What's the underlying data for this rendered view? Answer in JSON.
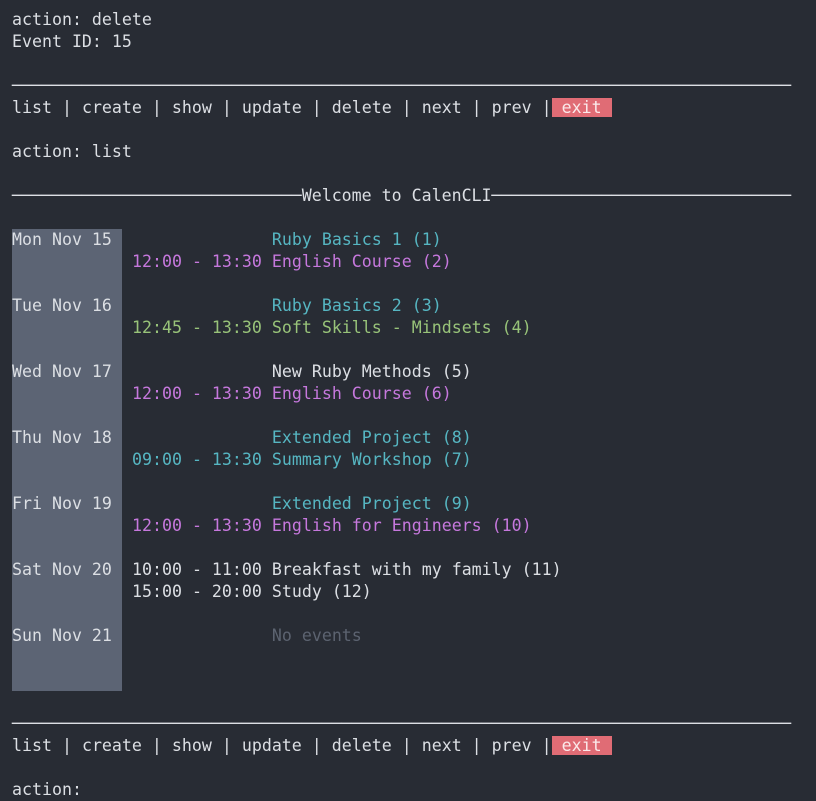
{
  "history": {
    "action_prev": "action: delete",
    "event_id": "Event ID: 15",
    "action_list": "action: list"
  },
  "menu": {
    "items": [
      "list",
      "create",
      "show",
      "update",
      "delete",
      "next",
      "prev"
    ],
    "exit": "exit"
  },
  "banner": "Welcome to CalenCLI",
  "prompt": "action:",
  "colors": {
    "background": "#282c34",
    "cyan": "#56b6c2",
    "magenta": "#c678dd",
    "green": "#98c379",
    "red": "#e06c75",
    "day_column": "#5c6474"
  },
  "days": [
    {
      "label": "Mon Nov 15",
      "events": [
        {
          "time": "",
          "title": "Ruby Basics 1 (1)",
          "color": "cyan"
        },
        {
          "time": "12:00 - 13:30",
          "title": "English Course (2)",
          "color": "magenta"
        }
      ]
    },
    {
      "label": "Tue Nov 16",
      "events": [
        {
          "time": "",
          "title": "Ruby Basics 2 (3)",
          "color": "cyan"
        },
        {
          "time": "12:45 - 13:30",
          "title": "Soft Skills - Mindsets (4)",
          "color": "green"
        }
      ]
    },
    {
      "label": "Wed Nov 17",
      "events": [
        {
          "time": "",
          "title": "New Ruby Methods (5)",
          "color": "white"
        },
        {
          "time": "12:00 - 13:30",
          "title": "English Course (6)",
          "color": "magenta"
        }
      ]
    },
    {
      "label": "Thu Nov 18",
      "events": [
        {
          "time": "",
          "title": "Extended Project (8)",
          "color": "cyan"
        },
        {
          "time": "09:00 - 13:30",
          "title": "Summary Workshop (7)",
          "color": "cyan"
        }
      ]
    },
    {
      "label": "Fri Nov 19",
      "events": [
        {
          "time": "",
          "title": "Extended Project (9)",
          "color": "cyan"
        },
        {
          "time": "12:00 - 13:30",
          "title": "English for Engineers (10)",
          "color": "magenta"
        }
      ]
    },
    {
      "label": "Sat Nov 20",
      "events": [
        {
          "time": "10:00 - 11:00",
          "title": "Breakfast with my family (11)",
          "color": "white"
        },
        {
          "time": "15:00 - 20:00",
          "title": "Study (12)",
          "color": "white"
        }
      ]
    },
    {
      "label": "Sun Nov 21",
      "events": [
        {
          "time": "",
          "title": "No events",
          "color": "dim"
        }
      ]
    }
  ]
}
